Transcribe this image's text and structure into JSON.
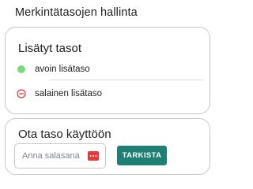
{
  "header": {
    "title": "Merkintätasojen hallinta"
  },
  "added_levels": {
    "title": "Lisätyt tasot",
    "items": [
      {
        "label": "avoin lisätaso",
        "status_icon": "open-dot-icon",
        "status_color": "#81d97f"
      },
      {
        "label": "salainen lisätaso",
        "status_icon": "locked-icon",
        "status_color": "#e53935"
      }
    ]
  },
  "enable_level": {
    "title": "Ota taso käyttöön",
    "password": {
      "placeholder": "Anna salasana",
      "value": "",
      "icon": "password-key-icon"
    },
    "check_label": "TARKISTA"
  },
  "colors": {
    "accent": "#1e7f74",
    "open": "#81d97f",
    "locked": "#e53935"
  }
}
